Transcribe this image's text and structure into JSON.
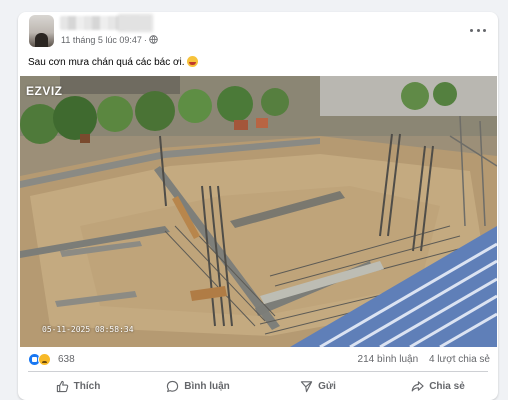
{
  "post": {
    "meta": "11 tháng 5 lúc 09:47",
    "caption": "Sau cơn mưa chán quá các bác ơi.",
    "emoji_icon": "sad-face-emoji",
    "visibility_icon": "globe-icon"
  },
  "photo": {
    "watermark": "EZVIZ",
    "timestamp": "05-11-2025 08:58:34"
  },
  "stats": {
    "reactions": "638",
    "reaction_icons": [
      "like",
      "sad"
    ],
    "comments": "214 bình luận",
    "shares": "4 lượt chia sẻ"
  },
  "actions": {
    "like": "Thích",
    "comment": "Bình luận",
    "send": "Gửi",
    "share": "Chia sẻ"
  },
  "colors": {
    "accent": "#1877f2",
    "muted_text": "#65676b",
    "background": "#f0f2f5"
  }
}
